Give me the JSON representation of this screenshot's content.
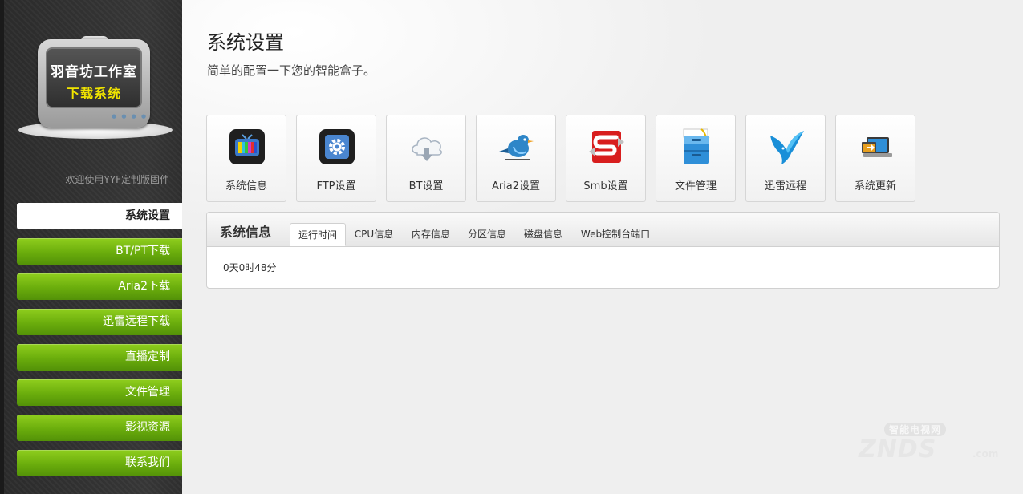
{
  "sidebar": {
    "logo": {
      "title": "羽音坊工作室",
      "subtitle": "下载系统"
    },
    "welcome": "欢迎使用YYF定制版固件",
    "nav": [
      {
        "label": "系统设置",
        "active": true
      },
      {
        "label": "BT/PT下载"
      },
      {
        "label": "Aria2下载"
      },
      {
        "label": "迅雷远程下载"
      },
      {
        "label": "直播定制"
      },
      {
        "label": "文件管理"
      },
      {
        "label": "影视资源"
      },
      {
        "label": "联系我们"
      }
    ]
  },
  "main": {
    "title": "系统设置",
    "subtitle": "简单的配置一下您的智能盒子。",
    "icons": [
      {
        "label": "系统信息",
        "icon": "tv-icon"
      },
      {
        "label": "FTP设置",
        "icon": "gear-icon"
      },
      {
        "label": "BT设置",
        "icon": "cloud-download-icon"
      },
      {
        "label": "Aria2设置",
        "icon": "bird-icon"
      },
      {
        "label": "Smb设置",
        "icon": "samba-icon"
      },
      {
        "label": "文件管理",
        "icon": "file-cabinet-icon"
      },
      {
        "label": "迅雷远程",
        "icon": "thunder-bird-icon"
      },
      {
        "label": "系统更新",
        "icon": "laptop-update-icon"
      }
    ],
    "panel": {
      "title": "系统信息",
      "tabs": [
        {
          "label": "运行时间",
          "active": true
        },
        {
          "label": "CPU信息"
        },
        {
          "label": "内存信息"
        },
        {
          "label": "分区信息"
        },
        {
          "label": "磁盘信息"
        },
        {
          "label": "Web控制台端口"
        }
      ],
      "content": "0天0时48分"
    }
  },
  "watermark": {
    "top": "智能电视网",
    "main": "ZNDS",
    "suffix": ".com"
  },
  "colors": {
    "nav_green": "#6aad0c",
    "sidebar_bg": "#333333"
  }
}
